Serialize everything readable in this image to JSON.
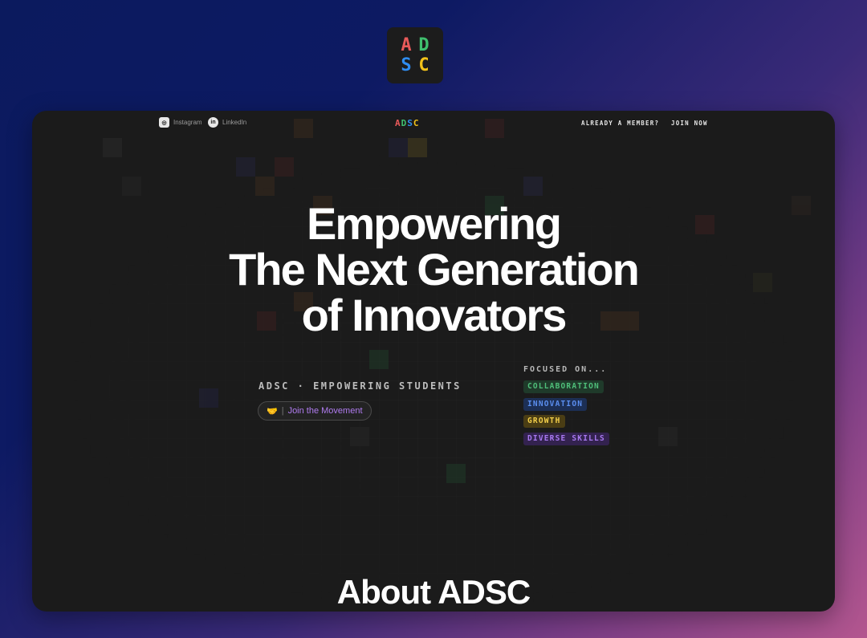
{
  "app_logo": {
    "letters": [
      "A",
      "D",
      "S",
      "C"
    ],
    "colors": [
      "#e85a5a",
      "#3fbf6e",
      "#2f8cf0",
      "#f2c21a"
    ]
  },
  "nav": {
    "instagram_label": "Instagram",
    "linkedin_label": "LinkedIn",
    "brand_letters": [
      "A",
      "D",
      "S",
      "C"
    ],
    "already_member": "ALREADY A MEMBER?",
    "join_now": "JOIN NOW"
  },
  "hero": {
    "line1": "Empowering",
    "line2": "The Next Generation",
    "line3": "of Innovators"
  },
  "tagline": "ADSC · EMPOWERING STUDENTS",
  "join_button": {
    "emoji": "🤝",
    "separator": "|",
    "label": "Join the Movement"
  },
  "focus": {
    "label": "FOCUSED ON...",
    "tags": [
      {
        "label": "COLLABORATION",
        "text_color": "#4fbf7a",
        "bg_color": "#1f3a2a"
      },
      {
        "label": "INNOVATION",
        "text_color": "#5b8ff0",
        "bg_color": "#1c2f55"
      },
      {
        "label": "GROWTH",
        "text_color": "#f2ce4a",
        "bg_color": "#4a3d14"
      },
      {
        "label": "DIVERSE SKILLS",
        "text_color": "#a879f0",
        "bg_color": "#33224f"
      }
    ]
  },
  "about_heading": "About ADSC"
}
